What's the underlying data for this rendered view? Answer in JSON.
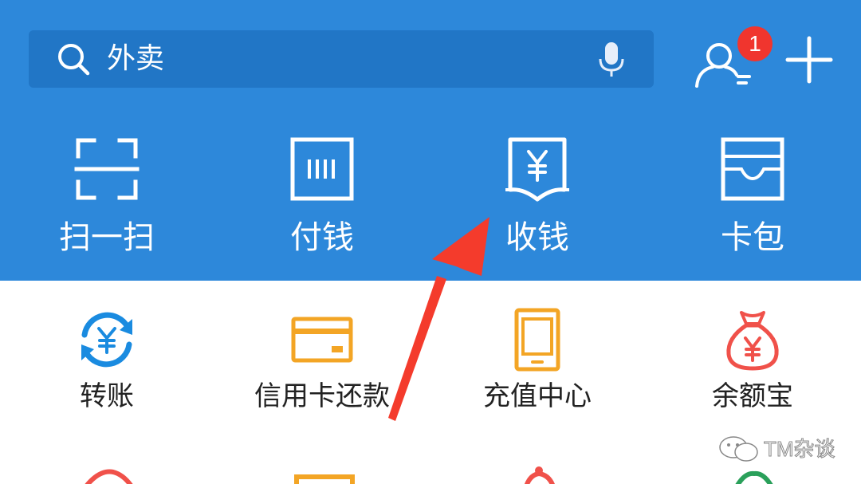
{
  "search": {
    "value": "外卖"
  },
  "header": {
    "badge_count": "1"
  },
  "top_actions": [
    {
      "label": "扫一扫",
      "icon": "scan-icon"
    },
    {
      "label": "付钱",
      "icon": "pay-icon"
    },
    {
      "label": "收钱",
      "icon": "receive-money-icon"
    },
    {
      "label": "卡包",
      "icon": "card-wallet-icon"
    }
  ],
  "services": [
    {
      "label": "转账",
      "icon": "transfer-icon",
      "color": "#1a8be0"
    },
    {
      "label": "信用卡还款",
      "icon": "credit-card-icon",
      "color": "#f3a525"
    },
    {
      "label": "充值中心",
      "icon": "phone-recharge-icon",
      "color": "#f3a525"
    },
    {
      "label": "余额宝",
      "icon": "money-bag-icon",
      "color": "#f0514a"
    }
  ],
  "watermark": {
    "text": "TM杂谈"
  },
  "colors": {
    "header_blue": "#2d88da",
    "search_bg": "#2176c6",
    "badge_red": "#f0352e",
    "arrow_red": "#f43b2c"
  }
}
